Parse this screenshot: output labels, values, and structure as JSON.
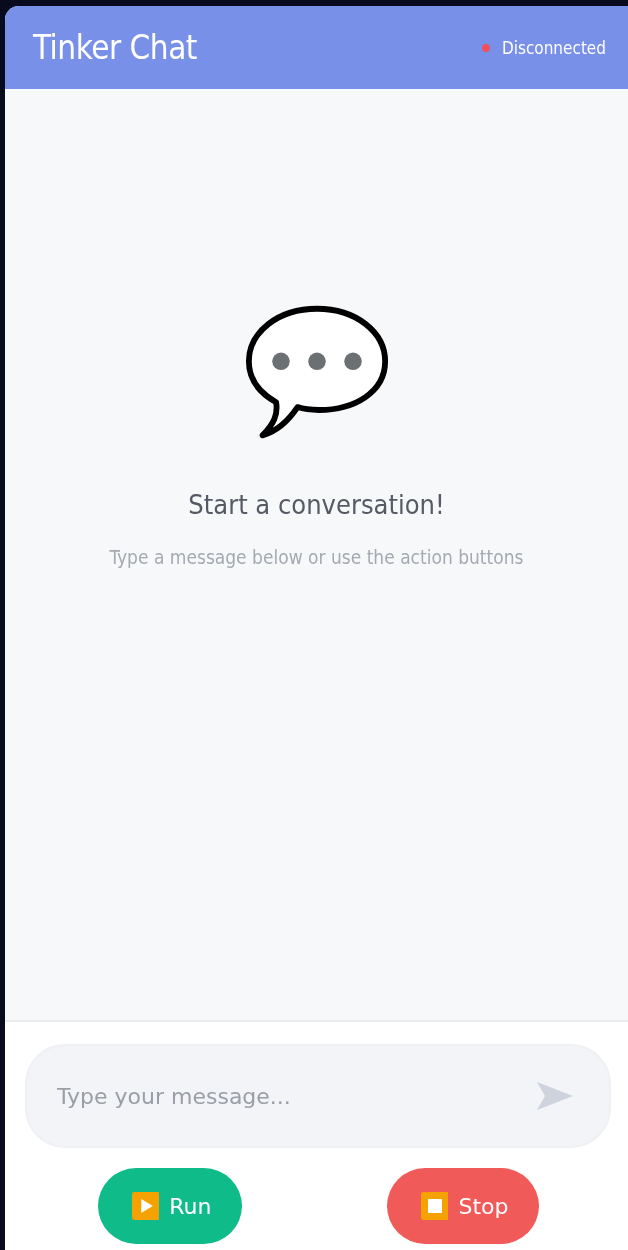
{
  "header": {
    "title": "Tinker Chat",
    "status": {
      "label": "Disconnected",
      "connected": false
    }
  },
  "empty_state": {
    "heading": "Start a conversation!",
    "hint": "Type a message below or use the action buttons"
  },
  "composer": {
    "placeholder": "Type your message..."
  },
  "actions": [
    {
      "kind": "run",
      "label": "Run"
    },
    {
      "kind": "stop",
      "label": "Stop"
    }
  ]
}
